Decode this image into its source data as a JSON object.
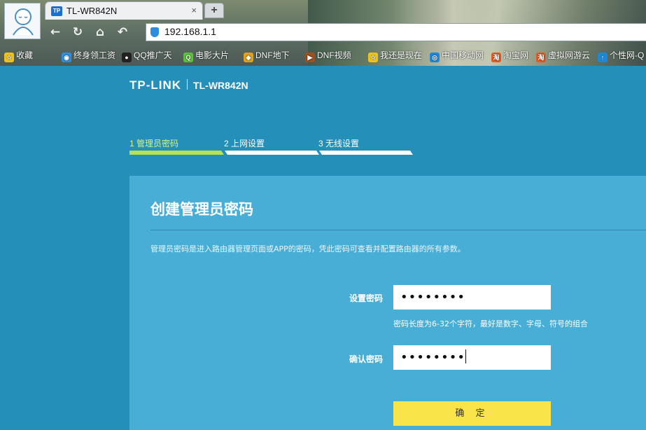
{
  "browser": {
    "tab_title": "TL-WR842N",
    "tab_favicon": "TP",
    "tab_close": "×",
    "new_tab": "+",
    "address": "192.168.1.1",
    "nav": {
      "back": "←",
      "reload": "↻",
      "home": "⌂",
      "undo": "↶"
    },
    "bookmarks": [
      {
        "label": "收藏",
        "icon": "star-icon",
        "color": "#f0c419"
      },
      {
        "label": "终身领工资",
        "icon": "globe-icon",
        "color": "#2f8fe0"
      },
      {
        "label": "QQ推广天",
        "icon": "qq-penguin-icon",
        "color": "#222222"
      },
      {
        "label": "电影大片",
        "icon": "q-video-icon",
        "color": "#5cc23b"
      },
      {
        "label": "DNF地下",
        "icon": "game-mask-icon",
        "color": "#e0a21b"
      },
      {
        "label": "DNF视频",
        "icon": "video-badge-icon",
        "color": "#a05020"
      },
      {
        "label": "我还是现在",
        "icon": "star-icon",
        "color": "#f0c419"
      },
      {
        "label": "中国移动网",
        "icon": "mobile-icon",
        "color": "#1e88d6"
      },
      {
        "label": "淘宝网",
        "icon": "taobao-icon",
        "color": "#e85a1c"
      },
      {
        "label": "虚拟网游云",
        "icon": "taobao-icon",
        "color": "#e85a1c"
      },
      {
        "label": "个性网-Q",
        "icon": "arrow-up-icon",
        "color": "#1e88d6"
      }
    ]
  },
  "router": {
    "brand": "TP-LINK",
    "model": "TL-WR842N",
    "steps": [
      {
        "label": "1 管理员密码",
        "active": true
      },
      {
        "label": "2 上网设置",
        "active": false
      },
      {
        "label": "3 无线设置",
        "active": false
      }
    ],
    "heading": "创建管理员密码",
    "description": "管理员密码是进入路由器管理页面或APP的密码，凭此密码可查看并配置路由器的所有参数。",
    "password_label": "设置密码",
    "password_value": "••••••••",
    "password_hint": "密码长度为6-32个字符，最好是数字、字母、符号的组合",
    "confirm_label": "确认密码",
    "confirm_value": "••••••••",
    "submit_label": "确 定",
    "colors": {
      "background": "#248fb8",
      "panel": "#49aed5",
      "active_step": "#b7e24e",
      "button": "#f9e54a"
    }
  }
}
